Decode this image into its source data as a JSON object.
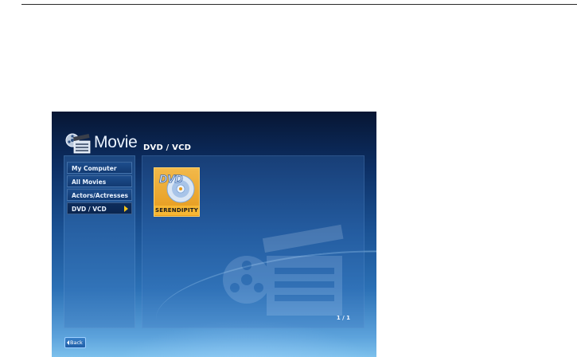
{
  "app": {
    "logo_text": "Movie",
    "logo_icon": "film-reel-clapperboard-icon"
  },
  "header": {
    "title": "DVD / VCD"
  },
  "sidebar": {
    "items": [
      {
        "label": "My Computer",
        "active": false
      },
      {
        "label": "All Movies",
        "active": false
      },
      {
        "label": "Actors/Actresses",
        "active": false
      },
      {
        "label": "DVD / VCD",
        "active": true
      }
    ]
  },
  "content": {
    "tiles": [
      {
        "label": "SERENDIPITY",
        "icon": "dvd-disc-icon",
        "selected": true
      }
    ],
    "pager": "1 / 1"
  },
  "footer": {
    "back_label": "Back"
  },
  "colors": {
    "accent": "#f4c319",
    "tile_highlight": "#f7b733",
    "bg_dark": "#071633",
    "bg_light": "#7cc0ec"
  }
}
